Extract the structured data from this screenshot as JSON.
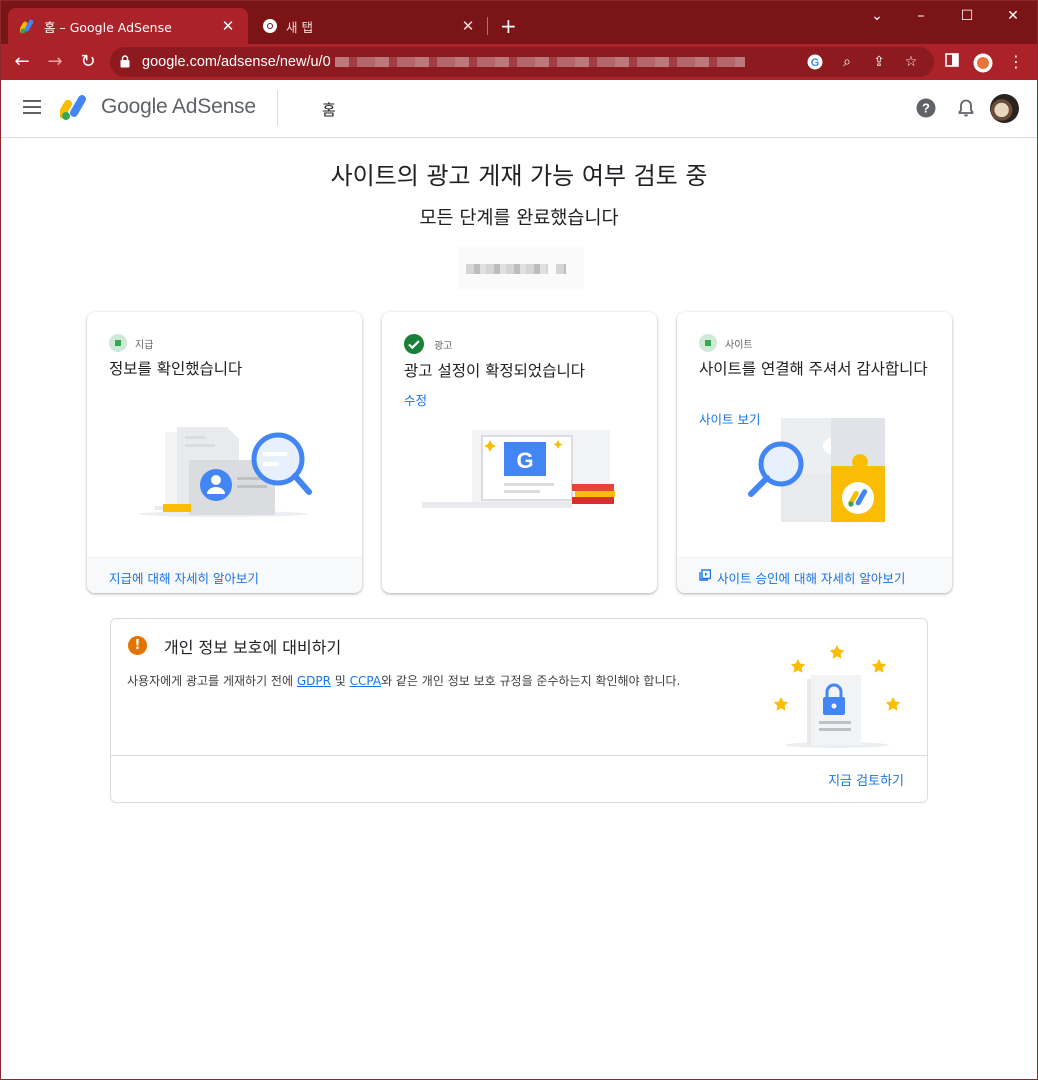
{
  "browser": {
    "tabs": [
      {
        "title": "홈 – Google AdSense",
        "close": "✕"
      },
      {
        "title": "새 탭",
        "close": "✕"
      }
    ],
    "new_tab": "+",
    "window_controls": {
      "minimize": "–",
      "maximize": "☐",
      "close": "✕",
      "tab_search": "⌄"
    },
    "url": "google.com/adsense/new/u/0",
    "icons": [
      "back-icon",
      "forward-icon",
      "reload-icon",
      "lock-icon",
      "google-icon",
      "zoom-icon",
      "share-icon",
      "star-icon",
      "sidepanel-icon",
      "profile-icon",
      "menu-dots-icon"
    ]
  },
  "app": {
    "logo_text": "Google AdSense",
    "page_title": "홈",
    "icons": [
      "hamburger-icon",
      "help-icon",
      "bell-icon",
      "avatar"
    ]
  },
  "main": {
    "heading": "사이트의 광고 게재 가능 여부 검토 중",
    "subheading": "모든 단계를 완료했습니다"
  },
  "cards": [
    {
      "step": "지급",
      "title": "정보를 확인했습니다",
      "link": "",
      "footer": "지급에 대해 자세히 알아보기"
    },
    {
      "step": "광고",
      "title": "광고 설정이 확정되었습니다",
      "link": "수정",
      "footer": ""
    },
    {
      "step": "사이트",
      "title": "사이트를 연결해 주셔서 감사합니다",
      "link": "사이트 보기",
      "footer": "사이트 승인에 대해 자세히 알아보기"
    }
  ],
  "privacy": {
    "icon": "!",
    "title": "개인 정보 보호에 대비하기",
    "body_before": "사용자에게 광고를 게재하기 전에 ",
    "gdpr": "GDPR",
    "and": " 및 ",
    "ccpa": "CCPA",
    "body_after": "와 같은 개인 정보 보호 규정을 준수하는지 확인해야 합니다.",
    "action": "지금 검토하기"
  },
  "colors": {
    "chrome_dark": "#7a1416",
    "chrome_toolbar": "#ac2229",
    "link": "#1a73e8",
    "success": "#188038",
    "warning": "#e37400"
  }
}
